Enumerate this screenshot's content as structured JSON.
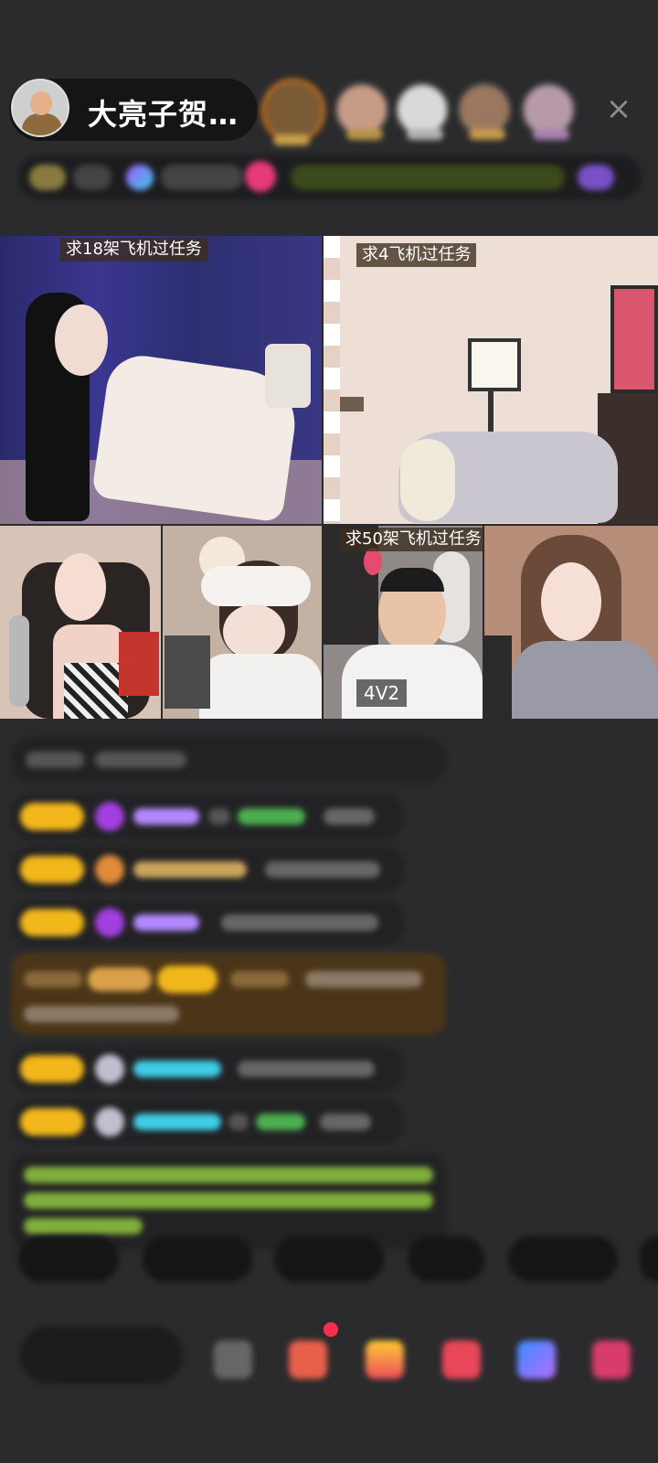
{
  "header": {
    "host_name": "大亮子贺…",
    "close_label": "×"
  },
  "video_grid": {
    "tiles": [
      {
        "label": "求18架飞机过任务"
      },
      {
        "label": "求4飞机过任务"
      },
      {
        "label": ""
      },
      {
        "label": ""
      },
      {
        "label": "求50架飞机过任务",
        "tag": "4V2"
      },
      {
        "label": ""
      }
    ]
  },
  "colors": {
    "background": "#2b2b2d",
    "badge_gold": "#f2b71b",
    "chat_name_purple": "#b388ff",
    "chat_name_cyan": "#3ecde6",
    "chat_name_green": "#4caf50",
    "system_text_green": "#8bc34a",
    "highlight_brown": "#4a3518"
  },
  "icons": [
    "close-icon",
    "gem-icon",
    "emoji-icon",
    "gift-icon",
    "more-icon"
  ]
}
